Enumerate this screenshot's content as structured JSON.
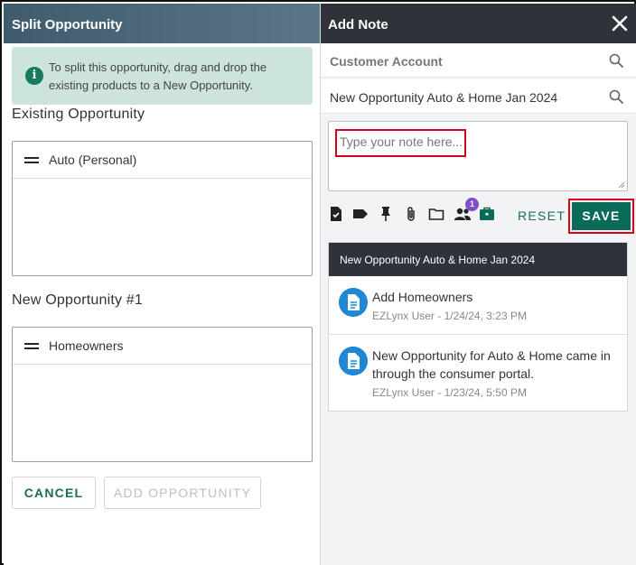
{
  "left": {
    "title": "Split Opportunity",
    "info": "To split this opportunity, drag and drop the existing products to a New Opportunity.",
    "existing_label": "Existing Opportunity",
    "existing_items": [
      "Auto (Personal)"
    ],
    "new_label": "New Opportunity #1",
    "new_items": [
      "Homeowners"
    ],
    "cancel_label": "CANCEL",
    "add_label": "ADD OPPORTUNITY"
  },
  "right": {
    "title": "Add Note",
    "customer_account": "Customer Account",
    "opportunity": "New Opportunity Auto & Home Jan 2024",
    "note_placeholder": "Type your note here...",
    "toolbar_icons": [
      "task-icon",
      "tag-icon",
      "pin-icon",
      "attachment-icon",
      "folder-icon",
      "people-icon",
      "briefcase-icon"
    ],
    "people_badge": "1",
    "reset_label": "RESET",
    "save_label": "SAVE",
    "notes_header": "New Opportunity Auto & Home Jan 2024",
    "notes": [
      {
        "title": "Add Homeowners",
        "meta": "EZLynx User - 1/24/24, 3:23 PM"
      },
      {
        "title": "New Opportunity for Auto & Home came in through the consumer portal.",
        "meta": "EZLynx User - 1/23/24, 5:50 PM"
      }
    ]
  },
  "colors": {
    "accent": "#0b6b58",
    "highlight": "#d6001c",
    "header_dark": "#2f3238",
    "info_bg": "#cde4dd",
    "badge": "#7f4ec9",
    "note_icon": "#1e88d6"
  }
}
